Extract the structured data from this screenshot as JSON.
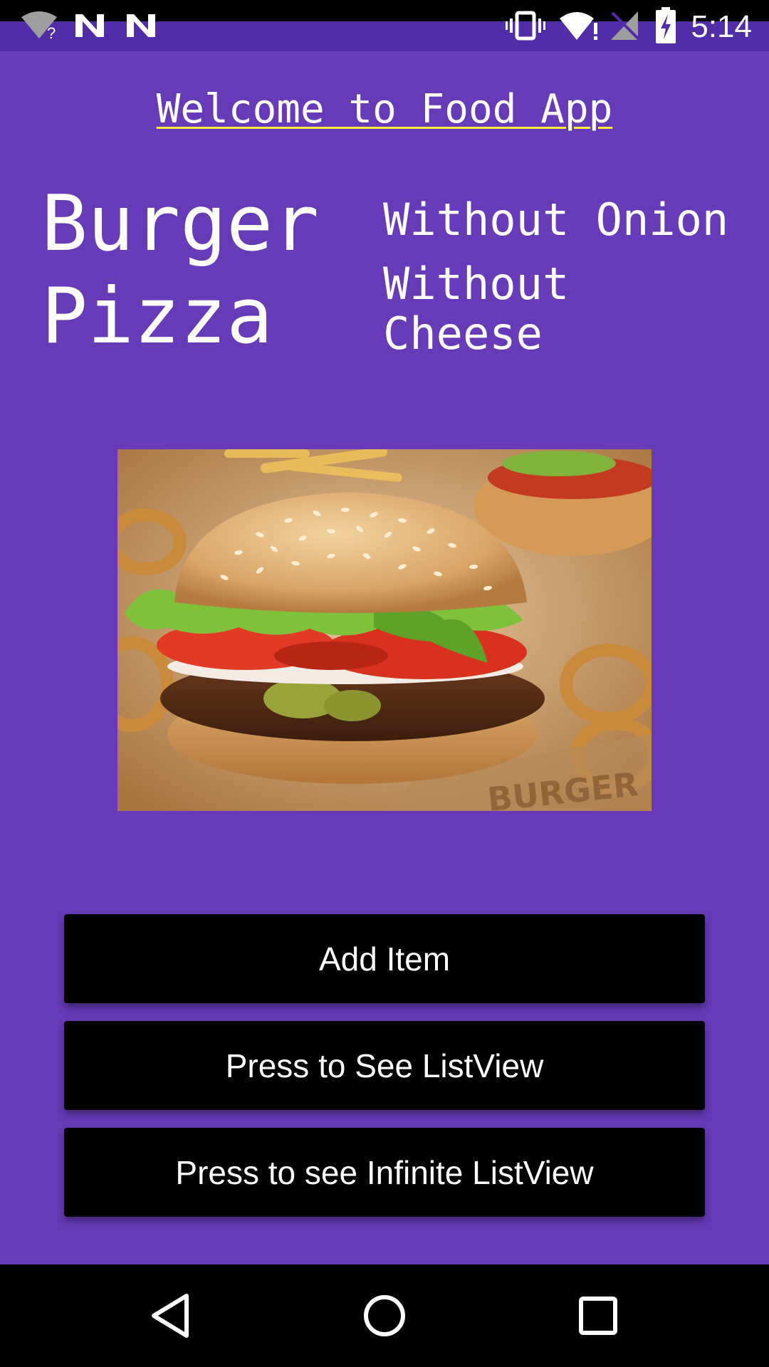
{
  "status_bar": {
    "time": "5:14",
    "icons": [
      "wifi-unknown-icon",
      "notification-n-icon",
      "notification-n-icon",
      "vibrate-icon",
      "wifi-warning-icon",
      "no-signal-icon",
      "battery-charging-icon"
    ]
  },
  "header": {
    "title": "Welcome to Food App"
  },
  "foods": {
    "item1": "Burger",
    "item2": "Pizza"
  },
  "options": {
    "option1": "Without Onion",
    "option2": "Without Cheese"
  },
  "image": {
    "subject": "burger-photo"
  },
  "buttons": {
    "add_item": "Add Item",
    "see_listview": "Press to See ListView",
    "see_infinite_listview": "Press to see Infinite ListView"
  },
  "nav_bar": {
    "icons": [
      "back-icon",
      "home-icon",
      "recents-icon"
    ]
  },
  "colors": {
    "background": "#673ab7",
    "status_bar": "#512da8",
    "button": "#000000",
    "underline": "#ffeb3b"
  }
}
